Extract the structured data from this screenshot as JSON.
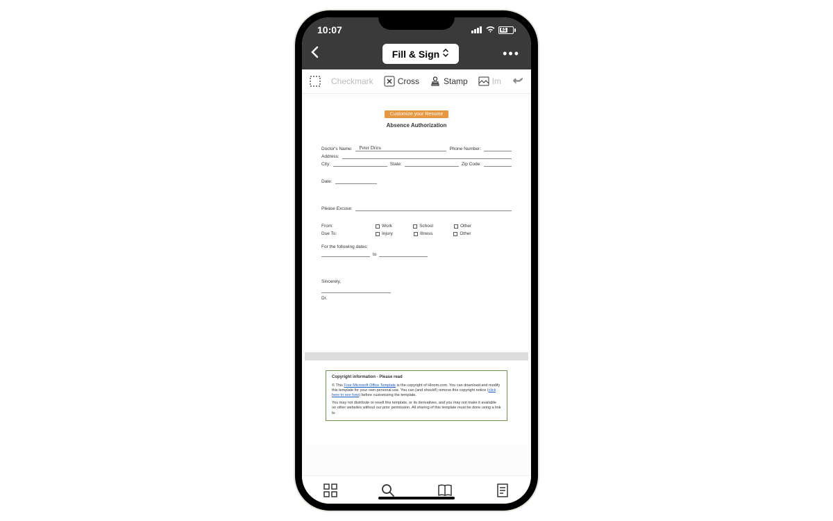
{
  "status": {
    "time": "10:07",
    "battery": "61"
  },
  "header": {
    "mode": "Fill & Sign"
  },
  "toolbar": {
    "checkmark": "Checkmark",
    "cross": "Cross",
    "stamp": "Stamp",
    "image": "Im"
  },
  "doc": {
    "customize": "Customize your Resume",
    "title": "Absence Authorization",
    "labels": {
      "doctor": "Doctor's Name:",
      "phone": "Phone Number:",
      "address": "Address:",
      "city": "City:",
      "state": "State:",
      "zip": "Zip Code:",
      "date": "Date:",
      "excuse": "Please Excuse:",
      "from": "From:",
      "dueTo": "Due To:",
      "forDates": "For the following dates:",
      "to": "to",
      "sincerely": "Sincerely,",
      "dr": "Dr."
    },
    "values": {
      "doctor": "Peter  Driru"
    },
    "checkFrom": {
      "work": "Work",
      "school": "School",
      "other": "Other"
    },
    "checkDue": {
      "injury": "Injury",
      "illness": "Illness",
      "other": "Other"
    }
  },
  "copyright": {
    "heading": "Copyright information - Please read",
    "p1a": "© This ",
    "link1": "Free Microsoft Office Template",
    "p1b": " is the copyright of Hloom.com. You can download and modify this template for your own personal use. You can (and should!) remove this copyright notice (",
    "link2": "click here to see how",
    "p1c": ") before customizing the template.",
    "p2": "You may not distribute or resell this template, or its derivatives, and you may not make it available on other websites without our prior permission. All sharing of this template must be done using a link to"
  }
}
